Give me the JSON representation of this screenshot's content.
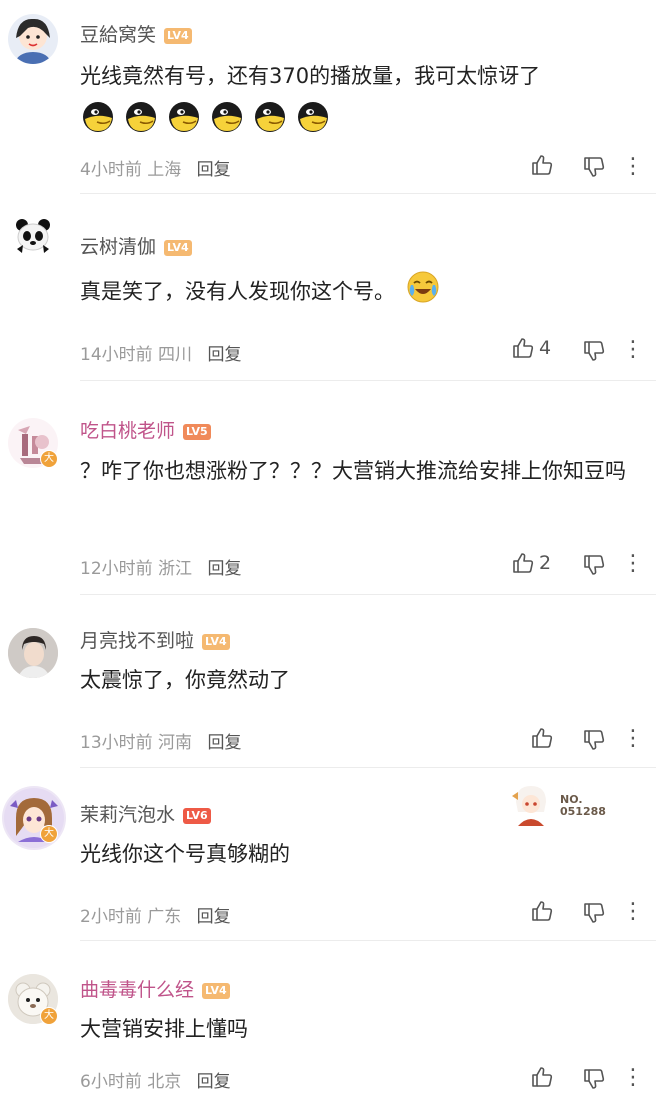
{
  "comments": [
    {
      "username": "豆給窝笑",
      "level": "LV4",
      "text": "光线竟然有号，还有370的播放量，我可太惊讶了",
      "time": "4小时前",
      "location": "上海",
      "reply": "回复",
      "likes": "",
      "emoji_count": 6
    },
    {
      "username": "云树清伽",
      "level": "LV4",
      "text": "真是笑了，没有人发现你这个号。",
      "time": "14小时前",
      "location": "四川",
      "reply": "回复",
      "likes": "4"
    },
    {
      "username": "吃白桃老师",
      "level": "LV5",
      "text": "？咋了你也想涨粉了？？？大营销大推流给安排上你知豆吗",
      "time": "12小时前",
      "location": "浙江",
      "reply": "回复",
      "likes": "2"
    },
    {
      "username": "月亮找不到啦",
      "level": "LV4",
      "text": "太震惊了，你竟然动了",
      "time": "13小时前",
      "location": "河南",
      "reply": "回复",
      "likes": ""
    },
    {
      "username": "茉莉汽泡水",
      "level": "LV6",
      "text": "光线你这个号真够糊的",
      "time": "2小时前",
      "location": "广东",
      "reply": "回复",
      "likes": "",
      "decoration_no": "NO.",
      "decoration_num": "051288"
    },
    {
      "username": "曲毒毒什么经",
      "level": "LV4",
      "text": "大营销安排上懂吗",
      "time": "6小时前",
      "location": "北京",
      "reply": "回复",
      "likes": ""
    }
  ],
  "colors": {
    "lv4": "#f5b971",
    "lv5": "#f08a5a",
    "lv6": "#ee5a46",
    "vip_name": "#c0548a",
    "icon": "#555555",
    "meta": "#9a9a9a"
  },
  "icons": [
    "thumbs-up-icon",
    "thumbs-down-icon",
    "more-vertical-icon",
    "verified-badge-icon",
    "laughing-emoji",
    "crying-laughing-emoji"
  ],
  "verified_badge": "大"
}
